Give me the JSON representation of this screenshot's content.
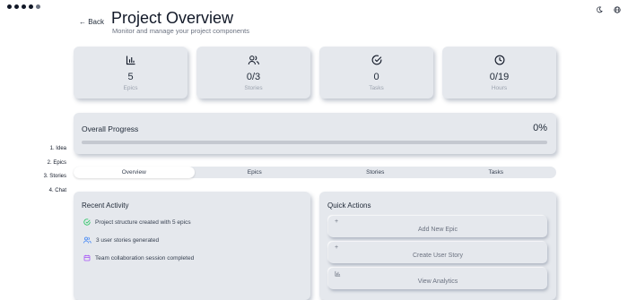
{
  "window": {
    "dots": 5
  },
  "header": {
    "back_label": "← Back",
    "title": "Project Overview",
    "subtitle": "Monitor and manage your project components"
  },
  "steps": [
    "1. Idea",
    "2. Epics",
    "3. Stories",
    "4. Chat"
  ],
  "stats": [
    {
      "icon": "bar-chart-icon",
      "value": "5",
      "label": "Epics"
    },
    {
      "icon": "users-icon",
      "value": "0/3",
      "label": "Stories"
    },
    {
      "icon": "check-circle-icon",
      "value": "0",
      "label": "Tasks"
    },
    {
      "icon": "clock-icon",
      "value": "0/19",
      "label": "Hours"
    }
  ],
  "progress": {
    "label": "Overall Progress",
    "percent_text": "0%",
    "fraction": 0
  },
  "tabs": [
    {
      "label": "Overview",
      "active": true
    },
    {
      "label": "Epics",
      "active": false
    },
    {
      "label": "Stories",
      "active": false
    },
    {
      "label": "Tasks",
      "active": false
    }
  ],
  "recent_activity": {
    "title": "Recent Activity",
    "items": [
      {
        "icon": "check-circle-icon",
        "color": "#22c55e",
        "text": "Project structure created with 5 epics"
      },
      {
        "icon": "users-icon",
        "color": "#3b82f6",
        "text": "3 user stories generated"
      },
      {
        "icon": "calendar-icon",
        "color": "#a855f7",
        "text": "Team collaboration session completed"
      }
    ]
  },
  "quick_actions": {
    "title": "Quick Actions",
    "items": [
      {
        "icon": "plus-icon",
        "glyph": "+",
        "label": "Add New Epic"
      },
      {
        "icon": "plus-icon",
        "glyph": "+",
        "label": "Create User Story"
      },
      {
        "icon": "bar-chart-icon",
        "glyph": "",
        "label": "View Analytics"
      }
    ]
  },
  "colors": {
    "card_bg": "#e5e8ed",
    "text": "#1f2937",
    "muted": "#6b7280"
  }
}
